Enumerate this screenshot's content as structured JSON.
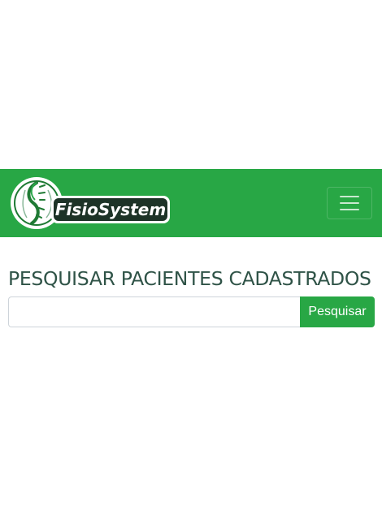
{
  "colors": {
    "brand_green": "#28a745",
    "heading_color": "#2f5347",
    "page_background": "#ffffff"
  },
  "navbar": {
    "logo_text": "FisioSystem",
    "logo_icon": "spine-icon",
    "toggle_icon": "hamburger-menu-icon"
  },
  "main": {
    "title": "PESQUISAR PACIENTES CADASTRADOS",
    "search": {
      "value": "",
      "placeholder": "",
      "button_label": "Pesquisar"
    }
  }
}
